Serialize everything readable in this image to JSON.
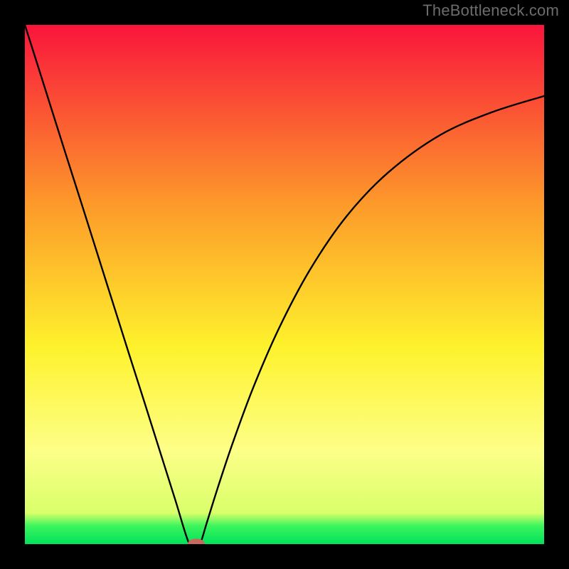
{
  "watermark": "TheBottleneck.com",
  "chart_data": {
    "type": "line",
    "title": "",
    "xlabel": "",
    "ylabel": "",
    "xlim": [
      0,
      100
    ],
    "ylim": [
      0,
      100
    ],
    "grid": false,
    "legend": false,
    "background_gradient": {
      "top": "#f9153c",
      "mid_upper": "#fd9b2a",
      "mid": "#fef22c",
      "lower": "#fdff88",
      "bottom_band": "#3bf55c",
      "bottom": "#02e15b"
    },
    "series": [
      {
        "name": "curve",
        "color": "#000000",
        "x": [
          0,
          2,
          5,
          8,
          11,
          14,
          17,
          20,
          23,
          26,
          29,
          31.6,
          33,
          33.8,
          35,
          37,
          40,
          44,
          49,
          55,
          62,
          70,
          80,
          90,
          100
        ],
        "y": [
          100,
          93.7,
          84.2,
          74.7,
          65.3,
          55.8,
          46.3,
          36.8,
          27.4,
          17.9,
          8.4,
          0.2,
          0.0,
          0.2,
          4,
          10.4,
          19.4,
          30.2,
          41.7,
          53,
          63.2,
          71.6,
          78.8,
          83.2,
          86.3
        ]
      }
    ],
    "marker": {
      "x": 33,
      "y": 0.15,
      "rx": 1.6,
      "ry": 0.9,
      "color": "#c66a5f"
    }
  }
}
